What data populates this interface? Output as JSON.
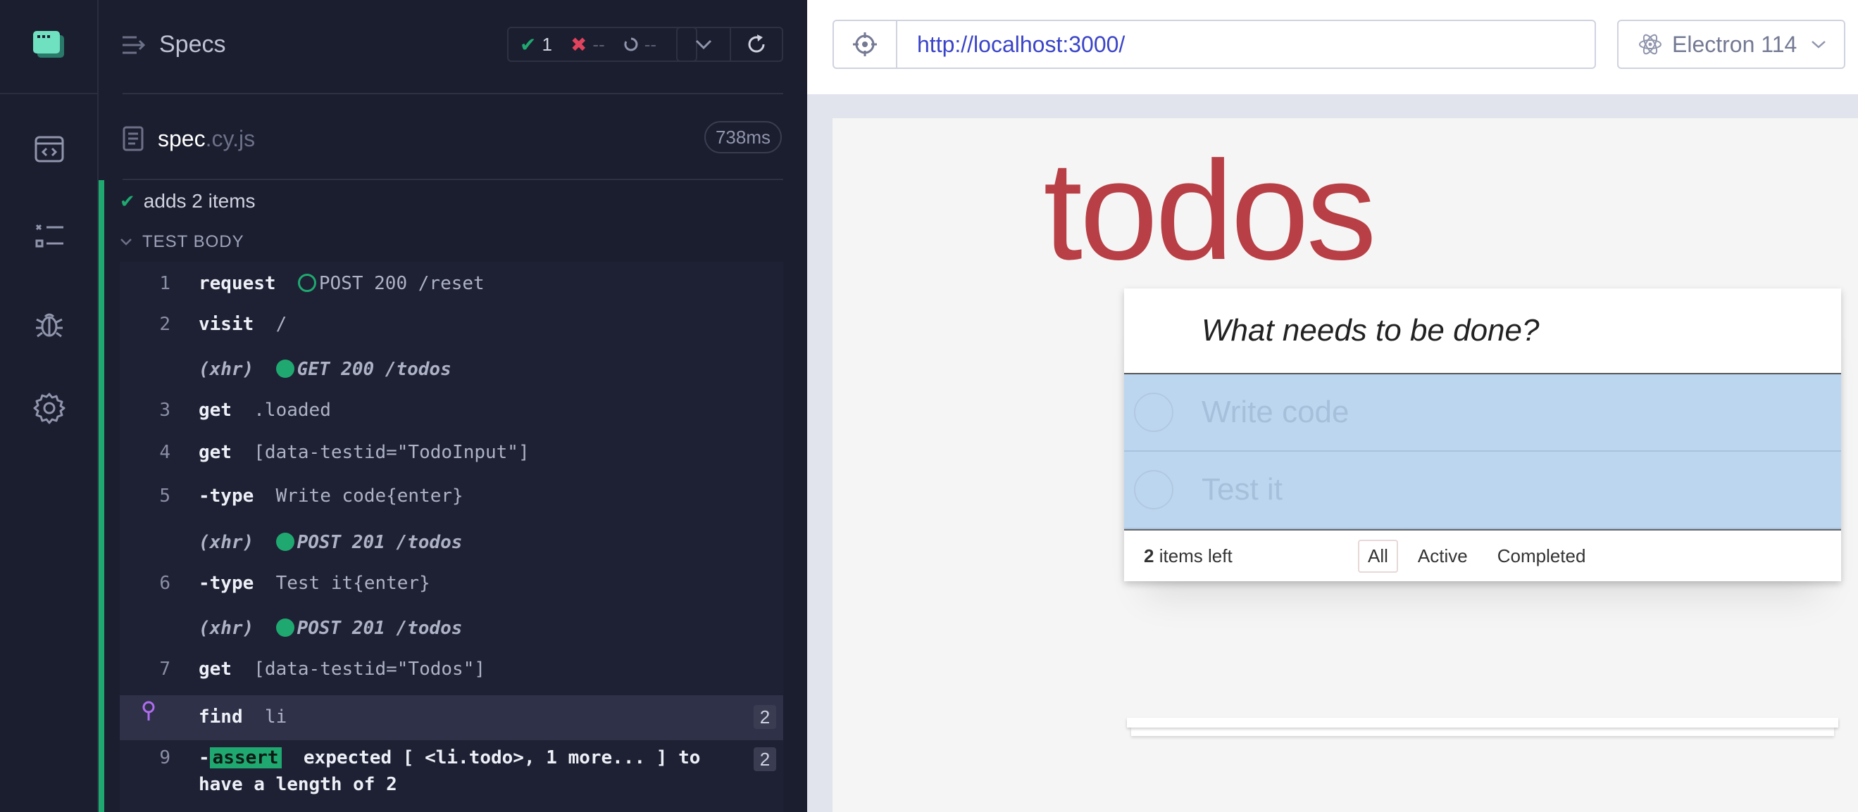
{
  "reporter": {
    "title": "Specs",
    "stats": {
      "passed": "1",
      "failed": "--",
      "pending": "--"
    },
    "spec": {
      "name": "spec",
      "ext": ".cy.js",
      "duration": "738ms"
    },
    "test_title": "adds 2 items",
    "section_title": "TEST BODY",
    "commands": [
      {
        "no": "1",
        "name": "request",
        "msg": "POST 200 /reset"
      },
      {
        "no": "2",
        "name": "visit",
        "msg": "/"
      },
      {
        "no": "",
        "name": "(xhr)",
        "msg": "GET 200 /todos"
      },
      {
        "no": "3",
        "name": "get",
        "msg": ".loaded"
      },
      {
        "no": "4",
        "name": "get",
        "msg": "[data-testid=\"TodoInput\"]"
      },
      {
        "no": "5",
        "name": "-type",
        "msg": "Write code{enter}"
      },
      {
        "no": "",
        "name": "(xhr)",
        "msg": "POST 201 /todos"
      },
      {
        "no": "6",
        "name": "-type",
        "msg": "Test it{enter}"
      },
      {
        "no": "",
        "name": "(xhr)",
        "msg": "POST 201 /todos"
      },
      {
        "no": "7",
        "name": "get",
        "msg": "[data-testid=\"Todos\"]"
      },
      {
        "no": "",
        "name": "find",
        "msg": "li",
        "badge": "2"
      },
      {
        "no": "9",
        "name": "-",
        "tag": "assert",
        "msg": "expected [ <li.todo>, 1 more... ] to",
        "msg2": "have a length of 2",
        "badge": "2"
      }
    ]
  },
  "browser": {
    "url": "http://localhost:3000/",
    "engine": "Electron 114"
  },
  "app": {
    "heading": "todos",
    "placeholder": "What needs to be done?",
    "items": [
      "Write code",
      "Test it"
    ],
    "count": "2",
    "count_suffix": " items left",
    "filters": [
      "All",
      "Active",
      "Completed"
    ]
  },
  "colors": {
    "pass": "#1fa971",
    "fail": "#e0435e",
    "brand_red": "#b83f45",
    "url_blue": "#3a44c8"
  }
}
